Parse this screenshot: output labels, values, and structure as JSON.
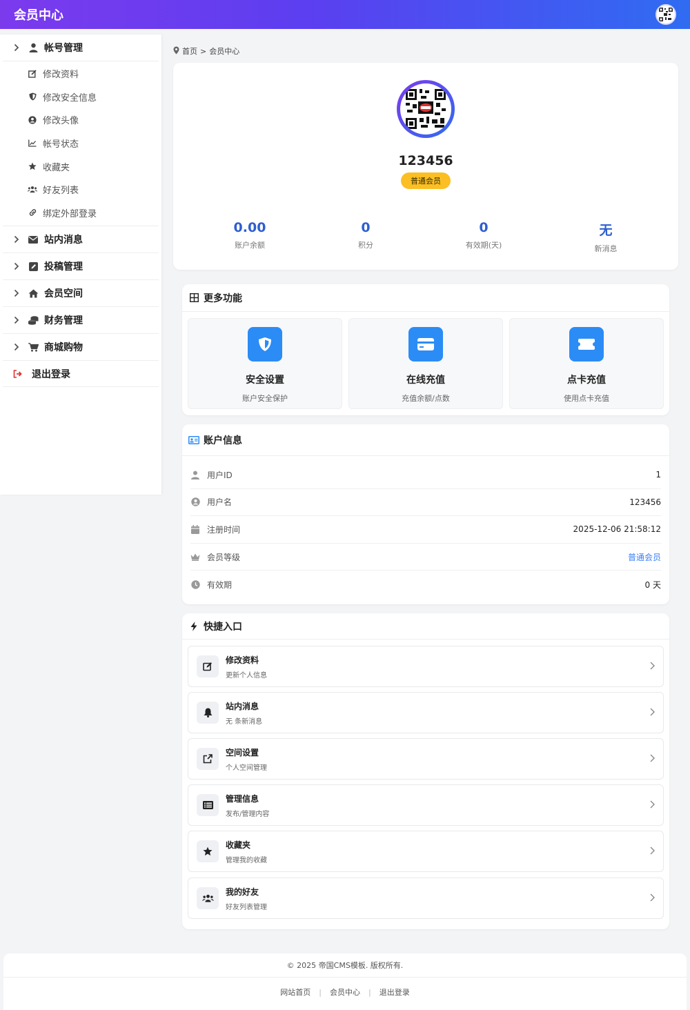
{
  "header": {
    "title": "会员中心",
    "avatar_icon": "qr-avatar-icon"
  },
  "sidebar": {
    "account_group": {
      "label": "帐号管理",
      "items": [
        {
          "label": "修改资料",
          "icon": "edit-icon"
        },
        {
          "label": "修改安全信息",
          "icon": "shield-icon"
        },
        {
          "label": "修改头像",
          "icon": "user-circle-icon"
        },
        {
          "label": "帐号状态",
          "icon": "chart-icon"
        },
        {
          "label": "收藏夹",
          "icon": "star-icon"
        },
        {
          "label": "好友列表",
          "icon": "users-icon"
        },
        {
          "label": "绑定外部登录",
          "icon": "link-icon"
        }
      ]
    },
    "groups": [
      {
        "label": "站内消息",
        "icon": "envelope-icon"
      },
      {
        "label": "投稿管理",
        "icon": "pencil-square-icon"
      },
      {
        "label": "会员空间",
        "icon": "home-icon"
      },
      {
        "label": "财务管理",
        "icon": "coins-icon"
      },
      {
        "label": "商城购物",
        "icon": "cart-icon"
      }
    ],
    "logout": "退出登录"
  },
  "breadcrumb": {
    "home": "首页",
    "sep": ">",
    "current": "会员中心"
  },
  "profile": {
    "username": "123456",
    "level": "普通会员",
    "stats": [
      {
        "value": "0.00",
        "label": "账户余额"
      },
      {
        "value": "0",
        "label": "积分"
      },
      {
        "value": "0",
        "label": "有效期(天)"
      },
      {
        "value": "无",
        "label": "新消息"
      }
    ]
  },
  "functions": {
    "title": "更多功能",
    "items": [
      {
        "title": "安全设置",
        "desc": "账户安全保护"
      },
      {
        "title": "在线充值",
        "desc": "充值余额/点数"
      },
      {
        "title": "点卡充值",
        "desc": "使用点卡充值"
      }
    ]
  },
  "account": {
    "title": "账户信息",
    "rows": [
      {
        "label": "用户ID",
        "value": "1"
      },
      {
        "label": "用户名",
        "value": "123456"
      },
      {
        "label": "注册时间",
        "value": "2025-12-06 21:58:12"
      },
      {
        "label": "会员等级",
        "value": "普通会员"
      },
      {
        "label": "有效期",
        "value": "0 天"
      }
    ]
  },
  "quick": {
    "title": "快捷入口",
    "items": [
      {
        "title": "修改资料",
        "desc": "更新个人信息"
      },
      {
        "title": "站内消息",
        "desc": "无 条新消息"
      },
      {
        "title": "空间设置",
        "desc": "个人空间管理"
      },
      {
        "title": "管理信息",
        "desc": "发布/管理内容"
      },
      {
        "title": "收藏夹",
        "desc": "管理我的收藏"
      },
      {
        "title": "我的好友",
        "desc": "好友列表管理"
      }
    ]
  },
  "footer": {
    "copyright": "© 2025 帝国CMS模板. 版权所有.",
    "links": [
      "网站首页",
      "会员中心",
      "退出登录"
    ],
    "sep": "|"
  },
  "colors": {
    "accent": "#2f5fd0",
    "badge": "#fbbf24",
    "tile": "#2b8cf6",
    "logout": "#e03131"
  }
}
